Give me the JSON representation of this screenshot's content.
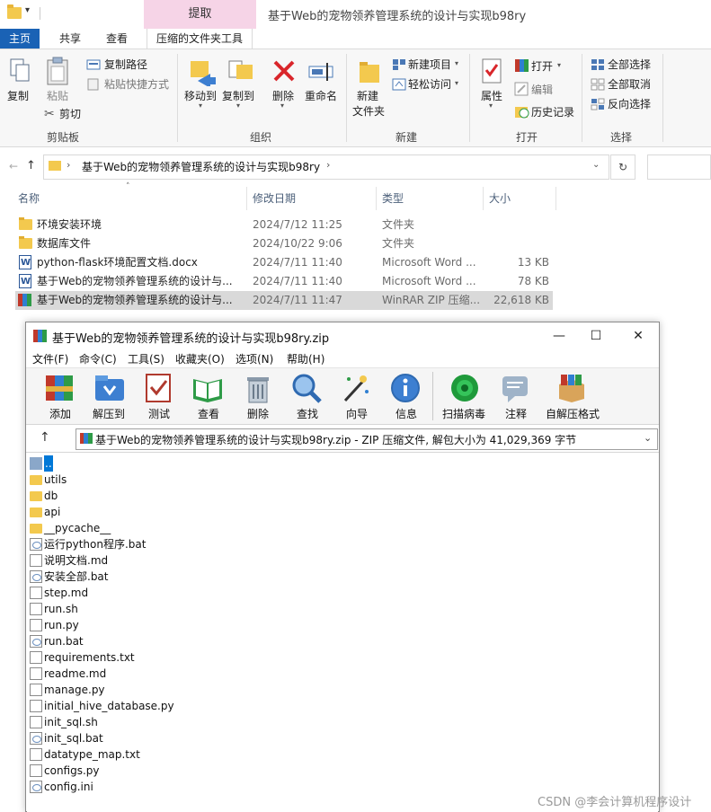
{
  "explorer": {
    "window_title": "基于Web的宠物领养管理系统的设计与实现b98ry",
    "context_tab_group": "提取",
    "tabs": [
      "主页",
      "共享",
      "查看",
      "压缩的文件夹工具"
    ],
    "ribbon": {
      "clipboard": {
        "group": "剪贴板",
        "copy": "复制",
        "paste": "粘贴",
        "copy_path": "复制路径",
        "paste_shortcut": "粘贴快捷方式",
        "cut": "剪切"
      },
      "organize": {
        "group": "组织",
        "move_to": "移动到",
        "copy_to": "复制到",
        "delete": "删除",
        "rename": "重命名"
      },
      "new": {
        "group": "新建",
        "new_folder_l1": "新建",
        "new_folder_l2": "文件夹",
        "new_item": "新建项目",
        "easy_access": "轻松访问"
      },
      "open": {
        "group": "打开",
        "properties": "属性",
        "open": "打开",
        "edit": "编辑",
        "history": "历史记录"
      },
      "select": {
        "group": "选择",
        "select_all": "全部选择",
        "select_none": "全部取消",
        "invert": "反向选择"
      }
    },
    "address": {
      "path": "基于Web的宠物领养管理系统的设计与实现b98ry"
    },
    "columns": [
      "名称",
      "修改日期",
      "类型",
      "大小"
    ],
    "files": [
      {
        "name": "环境安装环境",
        "date": "2024/7/12 11:25",
        "type": "文件夹",
        "size": "",
        "kind": "folder"
      },
      {
        "name": "数据库文件",
        "date": "2024/10/22 9:06",
        "type": "文件夹",
        "size": "",
        "kind": "folder"
      },
      {
        "name": "python-flask环境配置文档.docx",
        "date": "2024/7/11 11:40",
        "type": "Microsoft Word ...",
        "size": "13 KB",
        "kind": "doc"
      },
      {
        "name": "基于Web的宠物领养管理系统的设计与...",
        "date": "2024/7/11 11:40",
        "type": "Microsoft Word ...",
        "size": "78 KB",
        "kind": "doc"
      },
      {
        "name": "基于Web的宠物领养管理系统的设计与...",
        "date": "2024/7/11 11:47",
        "type": "WinRAR ZIP 压缩...",
        "size": "22,618 KB",
        "kind": "rar"
      }
    ]
  },
  "winrar": {
    "title": "基于Web的宠物领养管理系统的设计与实现b98ry.zip",
    "win_min": "—",
    "win_max": "☐",
    "win_close": "✕",
    "menu": [
      "文件(F)",
      "命令(C)",
      "工具(S)",
      "收藏夹(O)",
      "选项(N)",
      "帮助(H)"
    ],
    "toolbar": [
      "添加",
      "解压到",
      "测试",
      "查看",
      "删除",
      "查找",
      "向导",
      "信息",
      "扫描病毒",
      "注释",
      "自解压格式"
    ],
    "path_text": "基于Web的宠物领养管理系统的设计与实现b98ry.zip - ZIP 压缩文件, 解包大小为 41,029,369 字节",
    "items": [
      {
        "name": "..",
        "kind": "up"
      },
      {
        "name": "utils",
        "kind": "folder"
      },
      {
        "name": "db",
        "kind": "folder"
      },
      {
        "name": "api",
        "kind": "folder"
      },
      {
        "name": "__pycache__",
        "kind": "folder"
      },
      {
        "name": "运行python程序.bat",
        "kind": "bat"
      },
      {
        "name": "说明文档.md",
        "kind": "file"
      },
      {
        "name": "安装全部.bat",
        "kind": "bat"
      },
      {
        "name": "step.md",
        "kind": "file"
      },
      {
        "name": "run.sh",
        "kind": "file"
      },
      {
        "name": "run.py",
        "kind": "file"
      },
      {
        "name": "run.bat",
        "kind": "bat"
      },
      {
        "name": "requirements.txt",
        "kind": "file"
      },
      {
        "name": "readme.md",
        "kind": "file"
      },
      {
        "name": "manage.py",
        "kind": "file"
      },
      {
        "name": "initial_hive_database.py",
        "kind": "file"
      },
      {
        "name": "init_sql.sh",
        "kind": "file"
      },
      {
        "name": "init_sql.bat",
        "kind": "bat"
      },
      {
        "name": "datatype_map.txt",
        "kind": "file"
      },
      {
        "name": "configs.py",
        "kind": "file"
      },
      {
        "name": "config.ini",
        "kind": "bat"
      }
    ]
  },
  "watermark": "CSDN @李会计算机程序设计"
}
